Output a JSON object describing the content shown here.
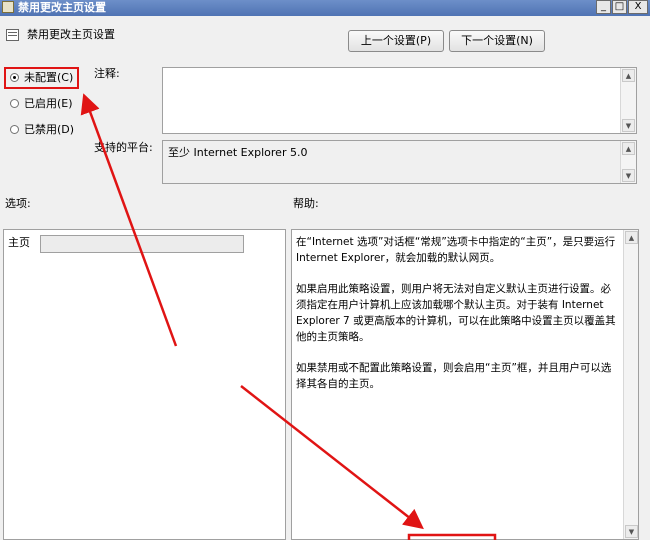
{
  "window": {
    "title": "禁用更改主页设置",
    "controls": {
      "minimize": "_",
      "maximize": "□",
      "close": "X"
    }
  },
  "header": {
    "title": "禁用更改主页设置"
  },
  "nav": {
    "prev_label": "上一个设置(P)",
    "next_label": "下一个设置(N)"
  },
  "state": {
    "options": [
      {
        "label": "未配置(C)",
        "selected": true
      },
      {
        "label": "已启用(E)",
        "selected": false
      },
      {
        "label": "已禁用(D)",
        "selected": false
      }
    ]
  },
  "comment": {
    "label": "注释:",
    "value": ""
  },
  "platform": {
    "label": "支持的平台:",
    "value": "至少 Internet Explorer 5.0"
  },
  "options_section": {
    "label": "选项:",
    "home_label": "主页",
    "home_value": ""
  },
  "help_section": {
    "label": "帮助:",
    "paragraphs": [
      "在“Internet 选项”对话框“常规”选项卡中指定的“主页”，是只要运行 Internet Explorer，就会加载的默认网页。",
      "如果启用此策略设置，则用户将无法对自定义默认主页进行设置。必须指定在用户计算机上应该加载哪个默认主页。对于装有 Internet Explorer 7 或更高版本的计算机，可以在此策略中设置主页以覆盖其他的主页策略。",
      "如果禁用或不配置此策略设置，则会启用“主页”框，并且用户可以选择其各自的主页。"
    ]
  },
  "annotation_color": "#e01414"
}
